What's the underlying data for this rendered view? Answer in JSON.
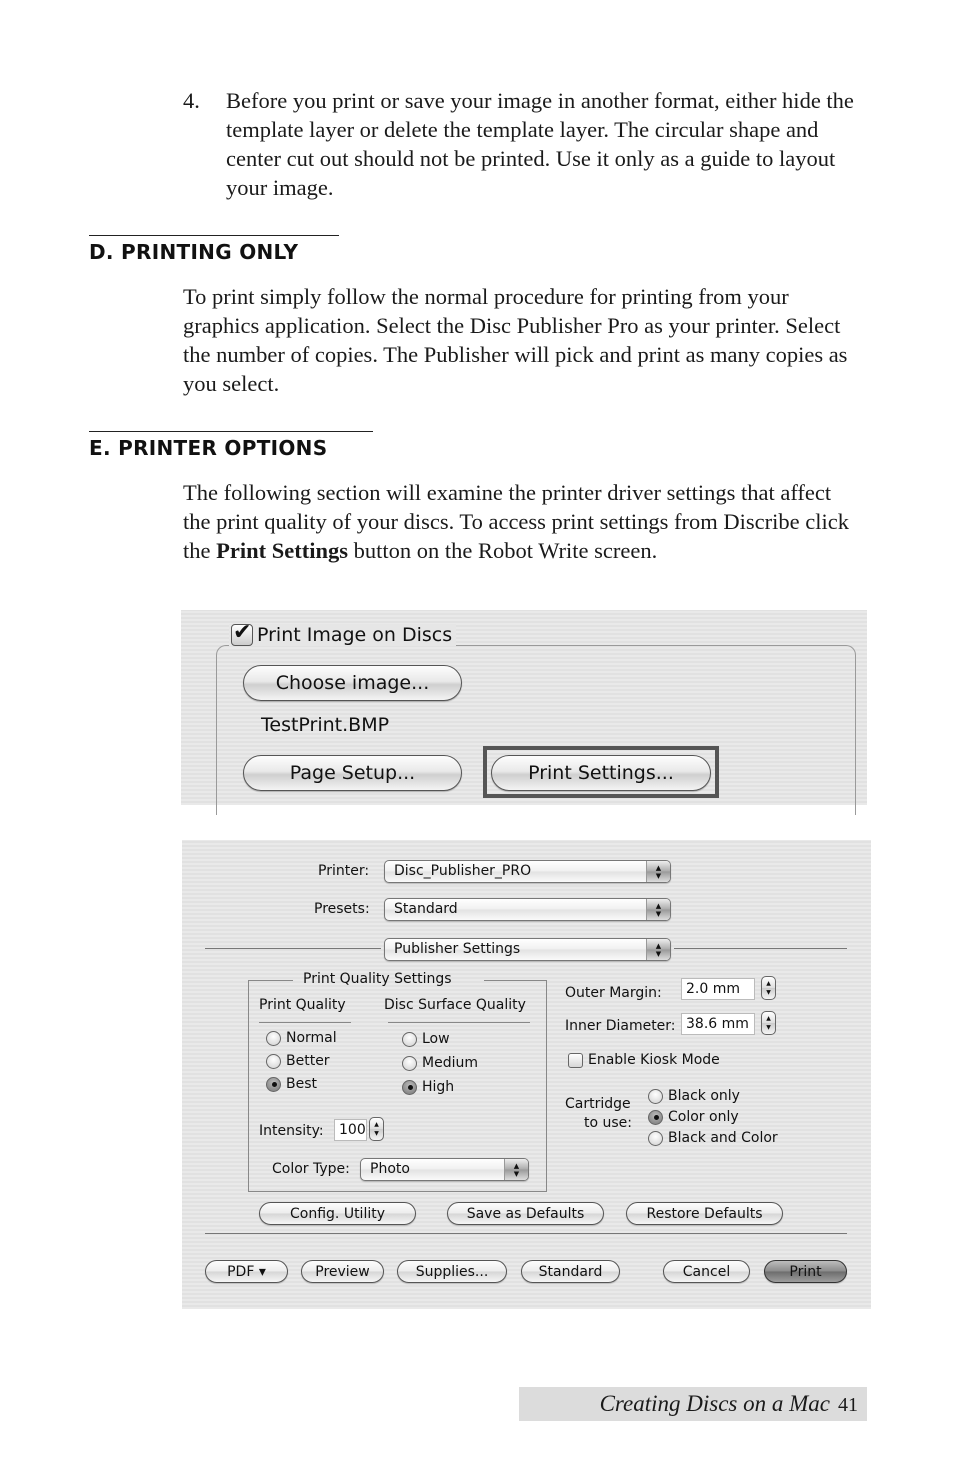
{
  "step": {
    "number": "4.",
    "text": "Before you print or save your image in another format, either hide the template layer or delete the template layer. The circular shape and center cut out should not be printed.  Use it only as a guide to layout your image."
  },
  "sections": {
    "d": {
      "heading": "D. PRINTING ONLY",
      "paragraph": "To print simply follow the normal procedure for printing from your graphics application.  Select the Disc Publisher Pro as your printer.  Select the number of copies.  The Publisher will pick and print as many copies as you select."
    },
    "e": {
      "heading": "E. PRINTER OPTIONS",
      "paragraph_before": "The following section will examine the printer driver settings that affect the print quality of your discs. To access print settings from Discribe click the ",
      "paragraph_bold": "Print Settings",
      "paragraph_after": " button on the Robot Write screen."
    }
  },
  "screenshot1": {
    "group_title": "Print Image on Discs",
    "print_image_checked": true,
    "choose_image_label": "Choose image...",
    "filename": "TestPrint.BMP",
    "page_setup_label": "Page Setup...",
    "print_settings_label": "Print Settings..."
  },
  "screenshot2": {
    "printer_label": "Printer:",
    "printer_value": "Disc_Publisher_PRO",
    "presets_label": "Presets:",
    "presets_value": "Standard",
    "panel_value": "Publisher Settings",
    "quality_group_title": "Print Quality Settings",
    "print_quality": {
      "label": "Print Quality",
      "options": [
        "Normal",
        "Better",
        "Best"
      ],
      "selected": "Best"
    },
    "surface_quality": {
      "label": "Disc Surface Quality",
      "options": [
        "Low",
        "Medium",
        "High"
      ],
      "selected": "High"
    },
    "intensity_label": "Intensity:",
    "intensity_value": "100",
    "color_type_label": "Color Type:",
    "color_type_value": "Photo",
    "outer_margin_label": "Outer Margin:",
    "outer_margin_value": "2.0 mm",
    "inner_diameter_label": "Inner Diameter:",
    "inner_diameter_value": "38.6 mm",
    "kiosk_label": "Enable Kiosk Mode",
    "kiosk_checked": false,
    "cartridge_label_1": "Cartridge",
    "cartridge_label_2": "to use:",
    "cartridge": {
      "options": [
        "Black only",
        "Color only",
        "Black and Color"
      ],
      "selected": "Color only"
    },
    "buttons": {
      "config": "Config. Utility",
      "save_defaults": "Save as Defaults",
      "restore_defaults": "Restore Defaults",
      "pdf": "PDF ▾",
      "preview": "Preview",
      "supplies": "Supplies...",
      "standard": "Standard",
      "cancel": "Cancel",
      "print": "Print"
    }
  },
  "footer": {
    "title": "Creating Discs on a Mac",
    "page": "41"
  }
}
